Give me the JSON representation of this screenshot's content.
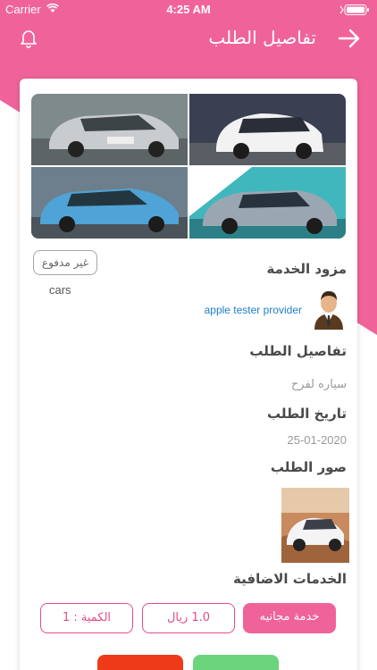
{
  "status_bar": {
    "carrier": "Carrier",
    "time": "4:25 AM"
  },
  "nav": {
    "title": "تفاصيل الطلب",
    "bell_icon": "bell-icon",
    "back_icon": "arrow-right-icon"
  },
  "colors": {
    "brand_pink": "#f0639a",
    "link_blue": "#1e7fc8",
    "accept_green": "#6cd47c",
    "reject_red": "#ee3a18"
  },
  "order": {
    "payment_status": "غير مدفوع",
    "category": "cars",
    "provider_heading": "مزود الخدمة",
    "provider_name": "apple tester provider",
    "details_heading": "تفاصيل الطلب",
    "details_text": "سياره لفرح",
    "date_heading": "تاريخ الطلب",
    "date_value": "25-01-2020",
    "images_heading": "صور الطلب",
    "extras_heading": "الخدمات الاضافية"
  },
  "extra_service": {
    "name": "خدمة مجانيه",
    "price": "1.0 ريال",
    "quantity": "الكمية : 1"
  },
  "actions": {
    "accept_label": "",
    "reject_label": ""
  }
}
